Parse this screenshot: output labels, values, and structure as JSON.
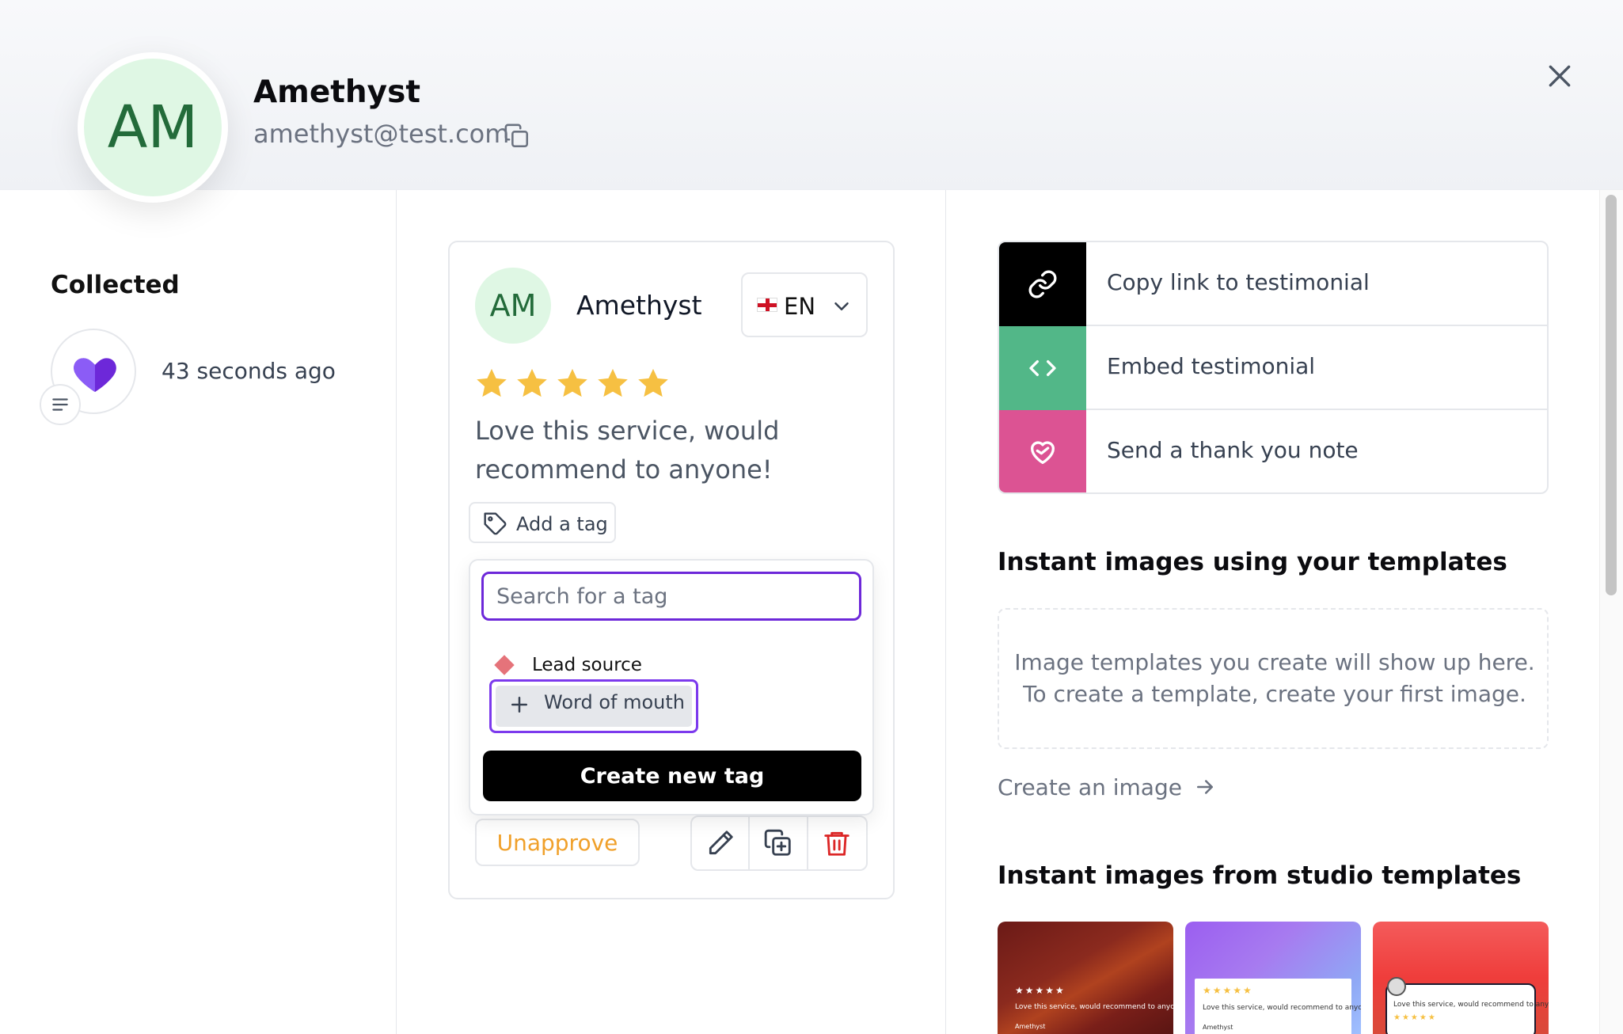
{
  "header": {
    "initials": "AM",
    "name": "Amethyst",
    "email": "amethyst@test.com"
  },
  "left": {
    "collected_title": "Collected",
    "collected_time": "43 seconds ago"
  },
  "card": {
    "initials": "AM",
    "name": "Amethyst",
    "language": "EN",
    "rating": 5,
    "review": "Love this service, would recommend to anyone!",
    "add_tag_label": "Add a tag",
    "unapprove_label": "Unapprove"
  },
  "tag_dropdown": {
    "search_placeholder": "Search for a tag",
    "existing_tag": "Lead source",
    "new_tag_suggestion": "Word of mouth",
    "create_label": "Create new tag"
  },
  "actions": [
    {
      "label": "Copy link to testimonial",
      "color": "#000000",
      "icon": "link-icon"
    },
    {
      "label": "Embed testimonial",
      "color": "#52b788",
      "icon": "code-icon"
    },
    {
      "label": "Send a thank you note",
      "color": "#dc5393",
      "icon": "heart-handshake-icon"
    }
  ],
  "templates": {
    "title": "Instant images using your templates",
    "empty_line1": "Image templates you create will show up here.",
    "empty_line2": "To create a template, create your first image.",
    "create_link": "Create an image"
  },
  "studio": {
    "title": "Instant images from studio templates",
    "thumb_text": "Love this service, would recommend to anyone!",
    "thumb_name": "Amethyst",
    "thumb_stars": "★★★★★"
  },
  "colors": {
    "accent_purple": "#6d28d9",
    "star": "#f6c042",
    "unapprove": "#f0a02a",
    "delete": "#dc2626"
  }
}
